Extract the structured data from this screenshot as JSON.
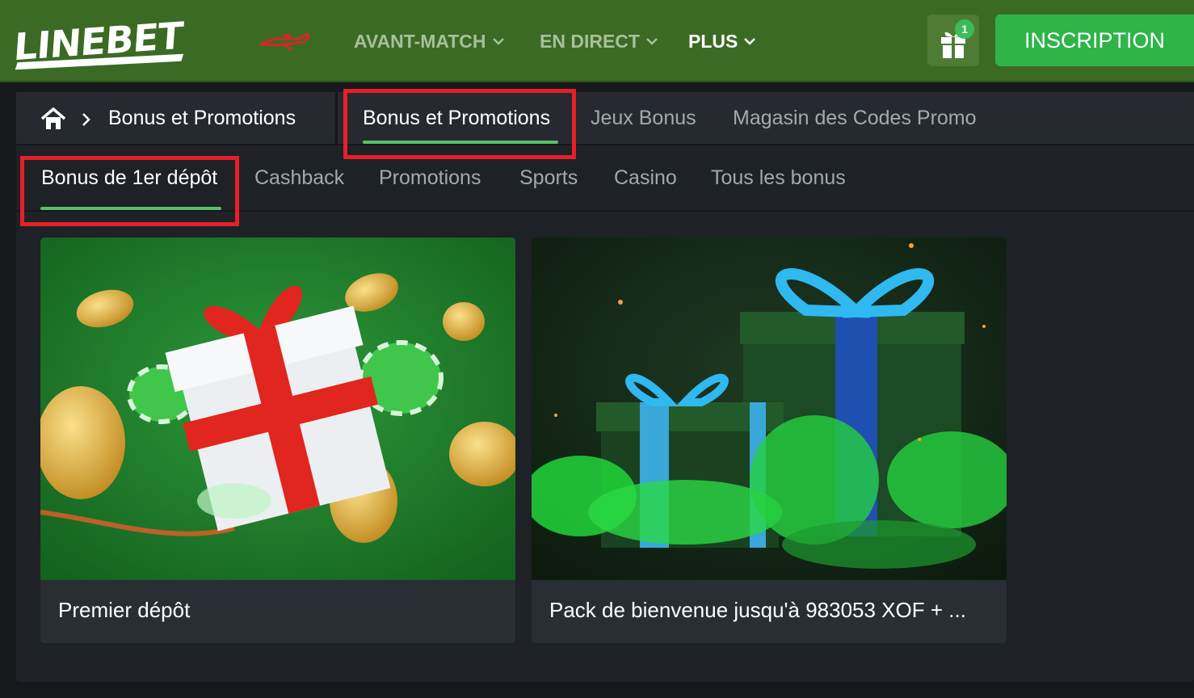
{
  "header": {
    "logo": "LINEBET",
    "nav": [
      {
        "label": "AVANT-MATCH"
      },
      {
        "label": "EN DIRECT"
      },
      {
        "label": "PLUS"
      }
    ],
    "gift_count": "1",
    "signup_label": "INSCRIPTION"
  },
  "breadcrumb": {
    "current": "Bonus et Promotions"
  },
  "tabs": [
    {
      "label": "Bonus et Promotions"
    },
    {
      "label": "Jeux Bonus"
    },
    {
      "label": "Magasin des Codes Promo"
    }
  ],
  "subtabs": [
    {
      "label": "Bonus de 1er dépôt"
    },
    {
      "label": "Cashback"
    },
    {
      "label": "Promotions"
    },
    {
      "label": "Sports"
    },
    {
      "label": "Casino"
    },
    {
      "label": "Tous les bonus"
    }
  ],
  "cards": [
    {
      "title": "Premier dépôt"
    },
    {
      "title": "Pack de bienvenue jusqu'à 983053 XOF + ..."
    }
  ],
  "colors": {
    "header_bg": "#3b6a24",
    "accent_green": "#2fb44a",
    "highlight_red": "#e5202a",
    "active_underline": "#55c168"
  }
}
